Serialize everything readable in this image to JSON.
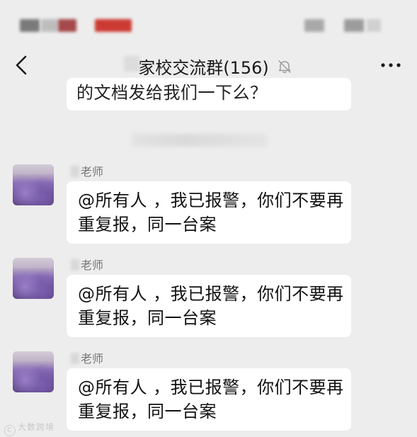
{
  "header": {
    "title": "家校交流群(156)"
  },
  "icons": {
    "back": "chevron-left-icon",
    "mute": "bell-muted-icon",
    "more": "more-dots-icon"
  },
  "previous_message": {
    "text": "的文档发给我们一下么？"
  },
  "messages": [
    {
      "sender": "老师",
      "text": "@所有人 ，我已报警，你们不要再重复报，同一台案"
    },
    {
      "sender": "老师",
      "text": "@所有人 ，我已报警，你们不要再重复报，同一台案"
    },
    {
      "sender": "老师",
      "text": "@所有人 ，我已报警，你们不要再重复报，同一台案"
    }
  ],
  "watermark": {
    "text": "大数跨境"
  }
}
